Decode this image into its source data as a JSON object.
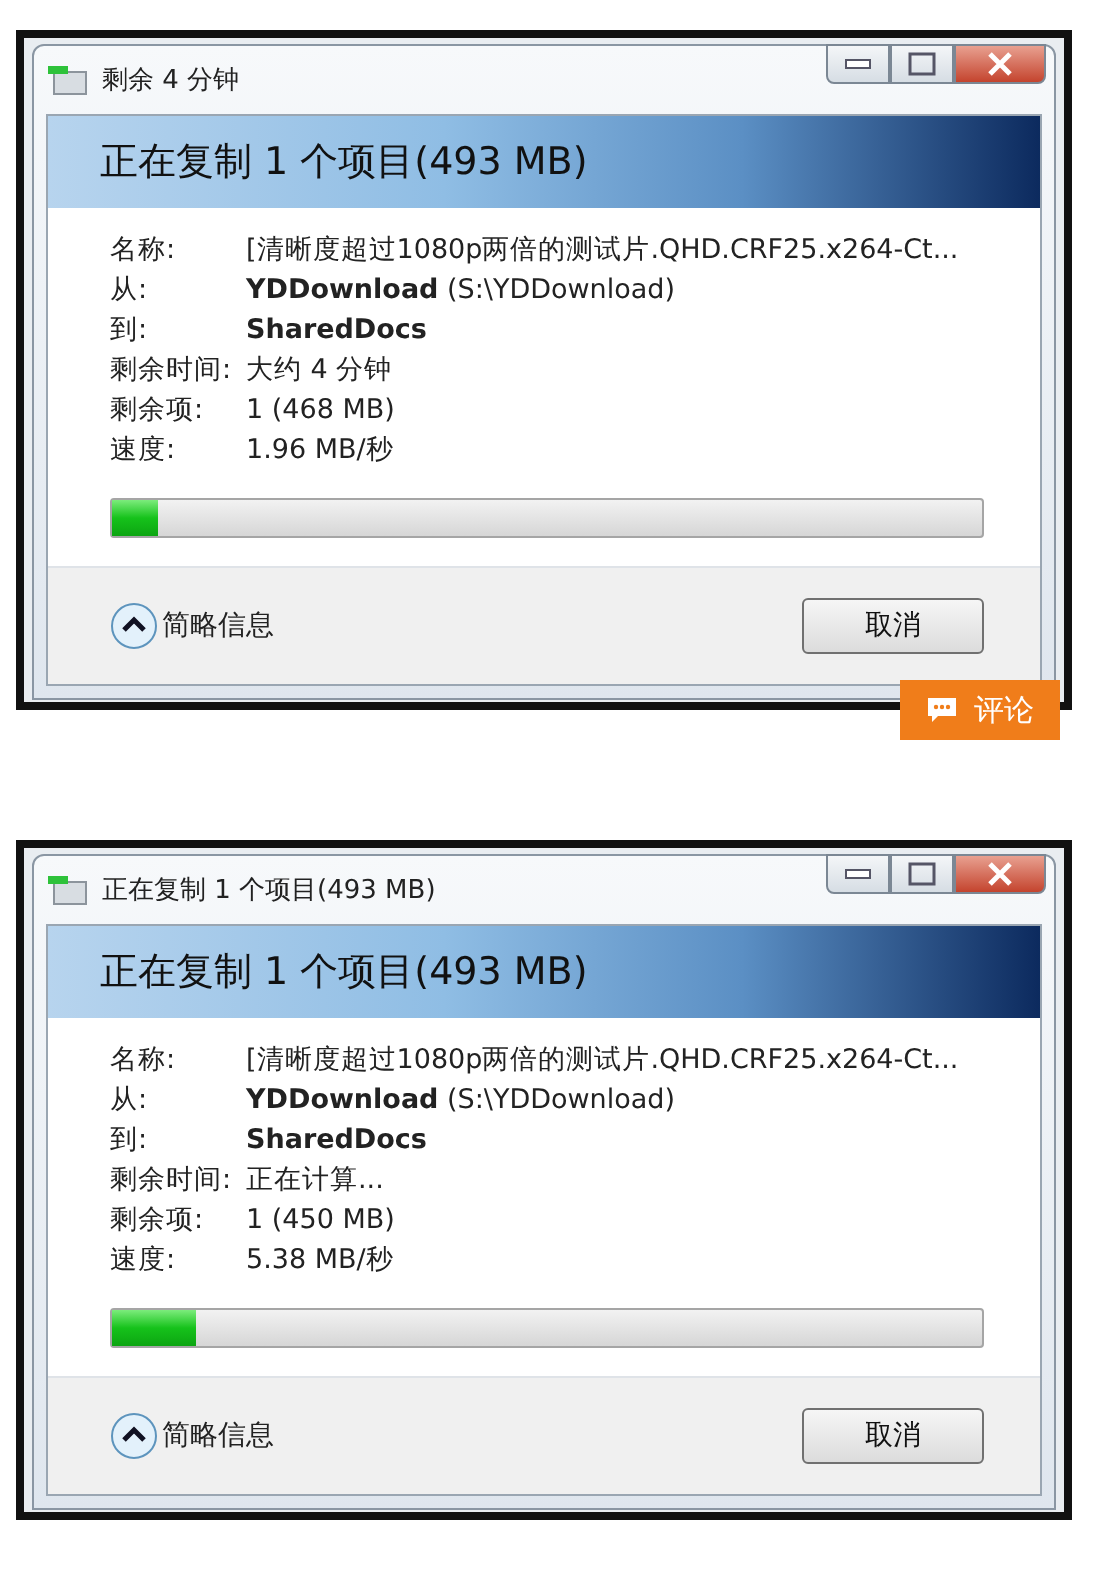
{
  "dialogs": [
    {
      "title": "剩余 4 分钟",
      "heading": "正在复制 1 个项目(493 MB)",
      "details": [
        {
          "label": "名称:",
          "kind": "text",
          "value": "[清晰度超过1080p两倍的测试片.QHD.CRF25.x264-Ct..."
        },
        {
          "label": "从:",
          "kind": "text",
          "value": "**YDDownload** (S:\\YDDownload)"
        },
        {
          "label": "到:",
          "kind": "place",
          "value": "SharedDocs"
        },
        {
          "label": "剩余时间:",
          "kind": "text",
          "value": "大约 4 分钟"
        },
        {
          "label": "剩余项:",
          "kind": "text",
          "value": "1 (468 MB)"
        },
        {
          "label": "速度:",
          "kind": "text",
          "value": "1.96 MB/秒"
        }
      ],
      "progress": {
        "level": 0.054
      },
      "details_toggle": "简略信息",
      "cancel_button": "取消"
    },
    {
      "title": "正在复制 1 个项目(493 MB)",
      "heading": "正在复制 1 个项目(493 MB)",
      "details": [
        {
          "label": "名称:",
          "kind": "text",
          "value": "[清晰度超过1080p两倍的测试片.QHD.CRF25.x264-Ct..."
        },
        {
          "label": "从:",
          "kind": "text",
          "value": "**YDDownload** (S:\\YDDownload)"
        },
        {
          "label": "到:",
          "kind": "place",
          "value": "SharedDocs"
        },
        {
          "label": "剩余时间:",
          "kind": "text",
          "value": "正在计算..."
        },
        {
          "label": "剩余项:",
          "kind": "text",
          "value": "1 (450 MB)"
        },
        {
          "label": "速度:",
          "kind": "text",
          "value": "5.38 MB/秒"
        }
      ],
      "progress": {
        "level": 0.097
      },
      "details_toggle": "简略信息",
      "cancel_button": "取消"
    }
  ],
  "comment_button": "评论"
}
